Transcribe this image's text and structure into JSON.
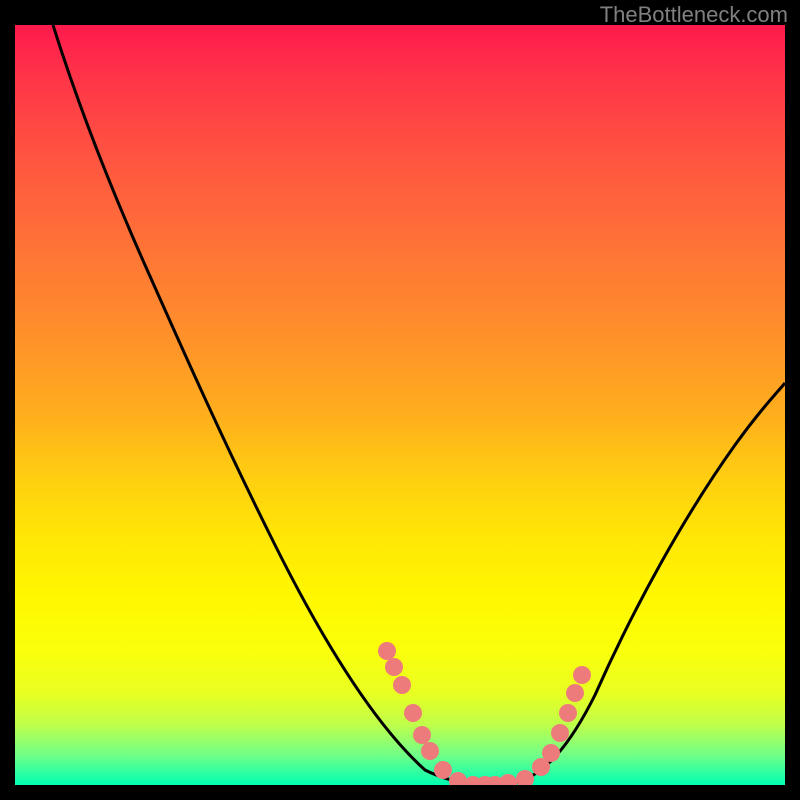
{
  "attribution": "TheBottleneck.com",
  "chart_data": {
    "type": "line",
    "title": "",
    "xlabel": "",
    "ylabel": "",
    "ylim": [
      0,
      100
    ],
    "xlim": [
      0,
      100
    ],
    "curve_points": [
      {
        "x": 5,
        "y": 100
      },
      {
        "x": 10,
        "y": 92
      },
      {
        "x": 15,
        "y": 82
      },
      {
        "x": 20,
        "y": 72
      },
      {
        "x": 25,
        "y": 62
      },
      {
        "x": 30,
        "y": 52
      },
      {
        "x": 35,
        "y": 42
      },
      {
        "x": 40,
        "y": 32
      },
      {
        "x": 45,
        "y": 22
      },
      {
        "x": 50,
        "y": 12
      },
      {
        "x": 55,
        "y": 4
      },
      {
        "x": 60,
        "y": 0
      },
      {
        "x": 65,
        "y": 0
      },
      {
        "x": 70,
        "y": 2
      },
      {
        "x": 75,
        "y": 12
      },
      {
        "x": 80,
        "y": 24
      },
      {
        "x": 85,
        "y": 34
      },
      {
        "x": 90,
        "y": 42
      },
      {
        "x": 95,
        "y": 48
      },
      {
        "x": 100,
        "y": 52
      }
    ],
    "highlight_points": [
      {
        "x": 49,
        "y": 17
      },
      {
        "x": 50,
        "y": 15
      },
      {
        "x": 51,
        "y": 12
      },
      {
        "x": 53,
        "y": 8
      },
      {
        "x": 54,
        "y": 5
      },
      {
        "x": 55,
        "y": 3
      },
      {
        "x": 57,
        "y": 1
      },
      {
        "x": 59,
        "y": 0
      },
      {
        "x": 61,
        "y": 0
      },
      {
        "x": 63,
        "y": 0
      },
      {
        "x": 64,
        "y": 0
      },
      {
        "x": 66,
        "y": 0
      },
      {
        "x": 68,
        "y": 1
      },
      {
        "x": 70,
        "y": 3
      },
      {
        "x": 71,
        "y": 5
      },
      {
        "x": 72,
        "y": 9
      },
      {
        "x": 73,
        "y": 12
      },
      {
        "x": 74,
        "y": 15
      },
      {
        "x": 75,
        "y": 18
      }
    ],
    "highlight_color": "#f08080"
  }
}
